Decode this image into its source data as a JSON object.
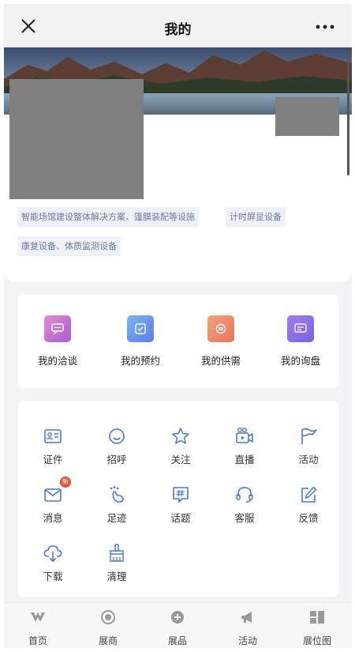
{
  "header": {
    "title": "我的"
  },
  "profile": {
    "tags": [
      "智能场馆建设整体解决方案、篷膜装配等设施",
      "计时屏显设备",
      "康复设备、体质监测设备"
    ]
  },
  "quick_links": [
    {
      "label": "我的洽谈",
      "icon": "chat-icon",
      "color": "#c56fcf"
    },
    {
      "label": "我的预约",
      "icon": "calendar-check-icon",
      "color": "#6f95ee"
    },
    {
      "label": "我的供需",
      "icon": "exchange-icon",
      "color": "#ef8e72"
    },
    {
      "label": "我的询盘",
      "icon": "message-icon",
      "color": "#8b74e6"
    }
  ],
  "services": [
    {
      "label": "证件",
      "icon": "id-card-icon"
    },
    {
      "label": "招呼",
      "icon": "smile-icon"
    },
    {
      "label": "关注",
      "icon": "star-icon"
    },
    {
      "label": "直播",
      "icon": "live-camera-icon"
    },
    {
      "label": "活动",
      "icon": "flag-icon"
    },
    {
      "label": "消息",
      "icon": "envelope-icon",
      "badge": "新"
    },
    {
      "label": "足迹",
      "icon": "footprint-icon"
    },
    {
      "label": "话题",
      "icon": "hashtag-icon"
    },
    {
      "label": "客服",
      "icon": "headset-icon"
    },
    {
      "label": "反馈",
      "icon": "edit-icon"
    },
    {
      "label": "下载",
      "icon": "cloud-download-icon"
    },
    {
      "label": "清理",
      "icon": "broom-icon"
    }
  ],
  "tabbar": [
    {
      "label": "首页",
      "icon": "home-logo-icon"
    },
    {
      "label": "展商",
      "icon": "exhibitor-icon"
    },
    {
      "label": "展品",
      "icon": "product-icon"
    },
    {
      "label": "活动",
      "icon": "megaphone-icon"
    },
    {
      "label": "展位图",
      "icon": "floor-map-icon"
    }
  ],
  "colors": {
    "accent_icon": "#4a79d4",
    "tag_text": "#6a7aa0",
    "tag_bg": "#eef1f7"
  }
}
